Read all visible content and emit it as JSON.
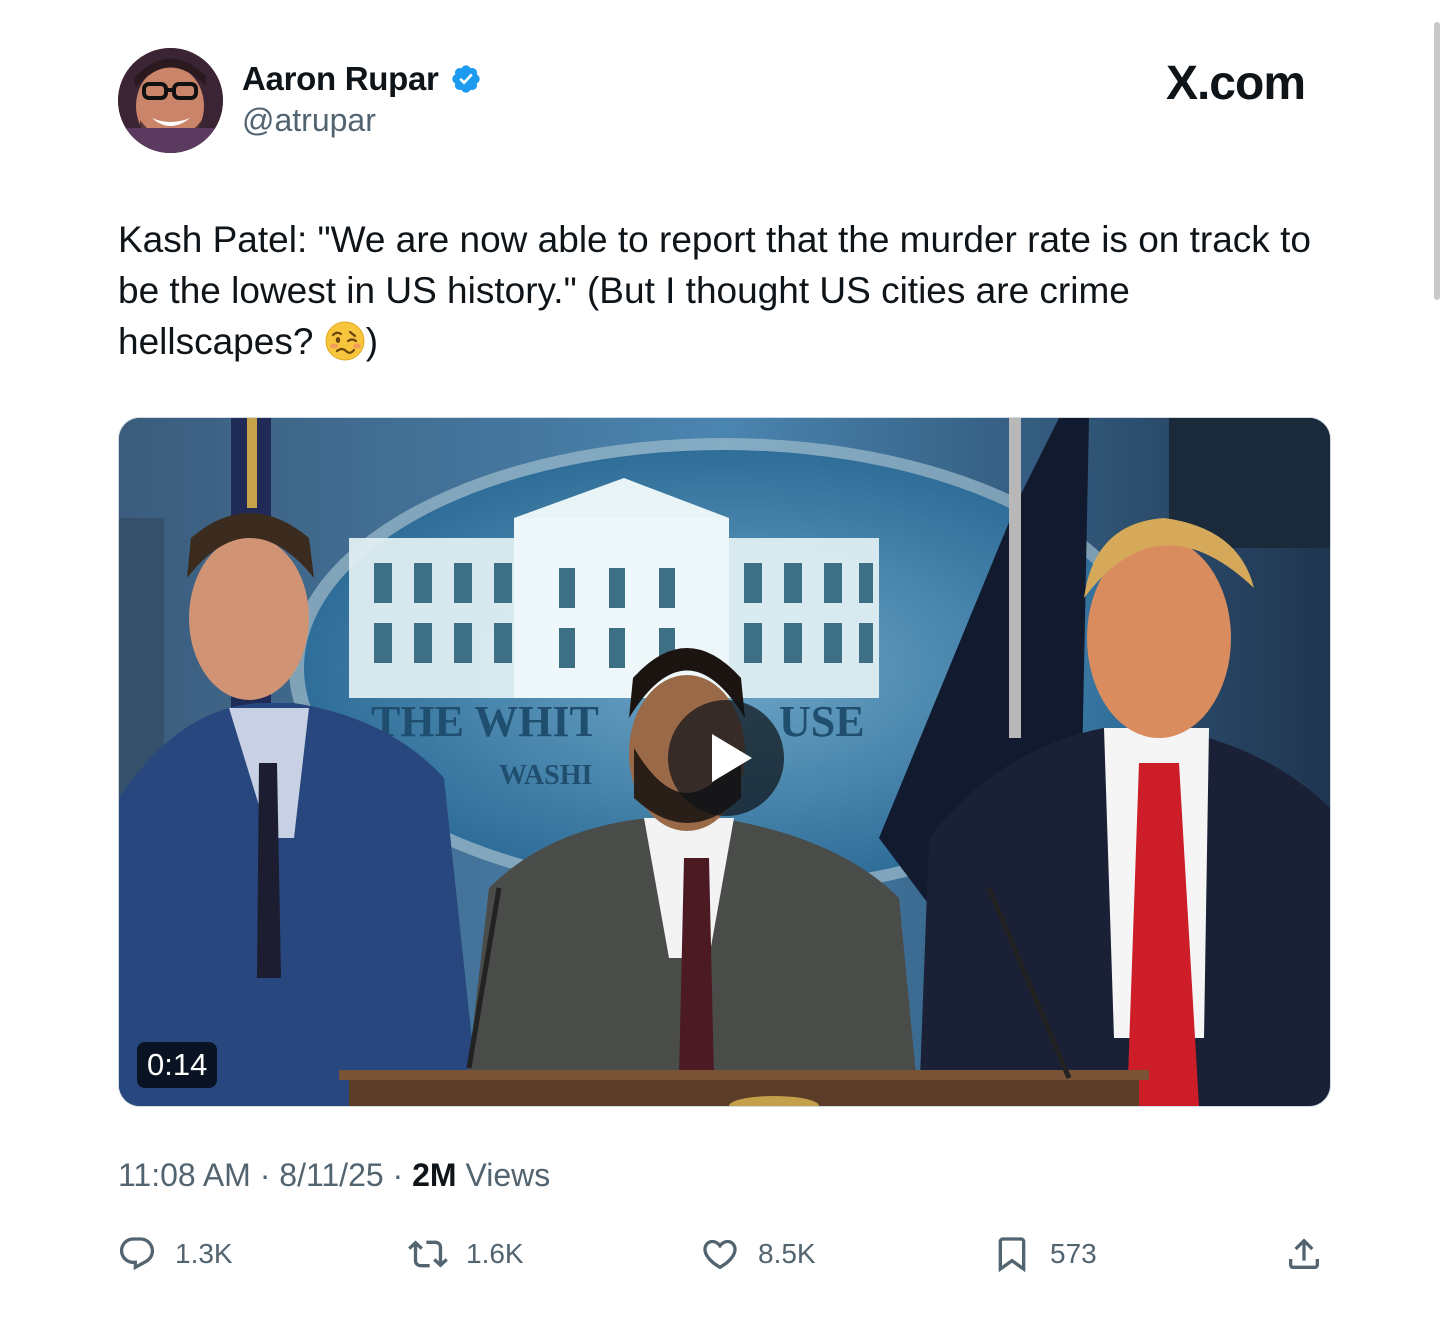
{
  "author": {
    "name": "Aaron Rupar",
    "handle": "@atrupar",
    "verified_color": "#1d9bf0"
  },
  "site": "X.com",
  "tweet": {
    "text": "Kash Patel: \"We are now able to report that the murder rate is on track to be the lowest in US history.\" (But I thought US cities are crime hellscapes? ",
    "emoji": "woozy-face",
    "text_end": ")"
  },
  "media": {
    "type": "video",
    "duration": "0:14",
    "backdrop_text_1": "THE WHIT",
    "backdrop_text_2": "USE",
    "backdrop_text_3": "WASHI"
  },
  "meta": {
    "time": "11:08 AM",
    "sep1": " · ",
    "date": "8/11/25",
    "sep2": " · ",
    "views_count": "2M",
    "views_label": " Views"
  },
  "actions": {
    "replies": "1.3K",
    "reposts": "1.6K",
    "likes": "8.5K",
    "bookmarks": "573"
  },
  "icons": [
    "verified-badge-icon",
    "play-icon",
    "reply-icon",
    "repost-icon",
    "like-icon",
    "bookmark-icon",
    "share-icon"
  ]
}
